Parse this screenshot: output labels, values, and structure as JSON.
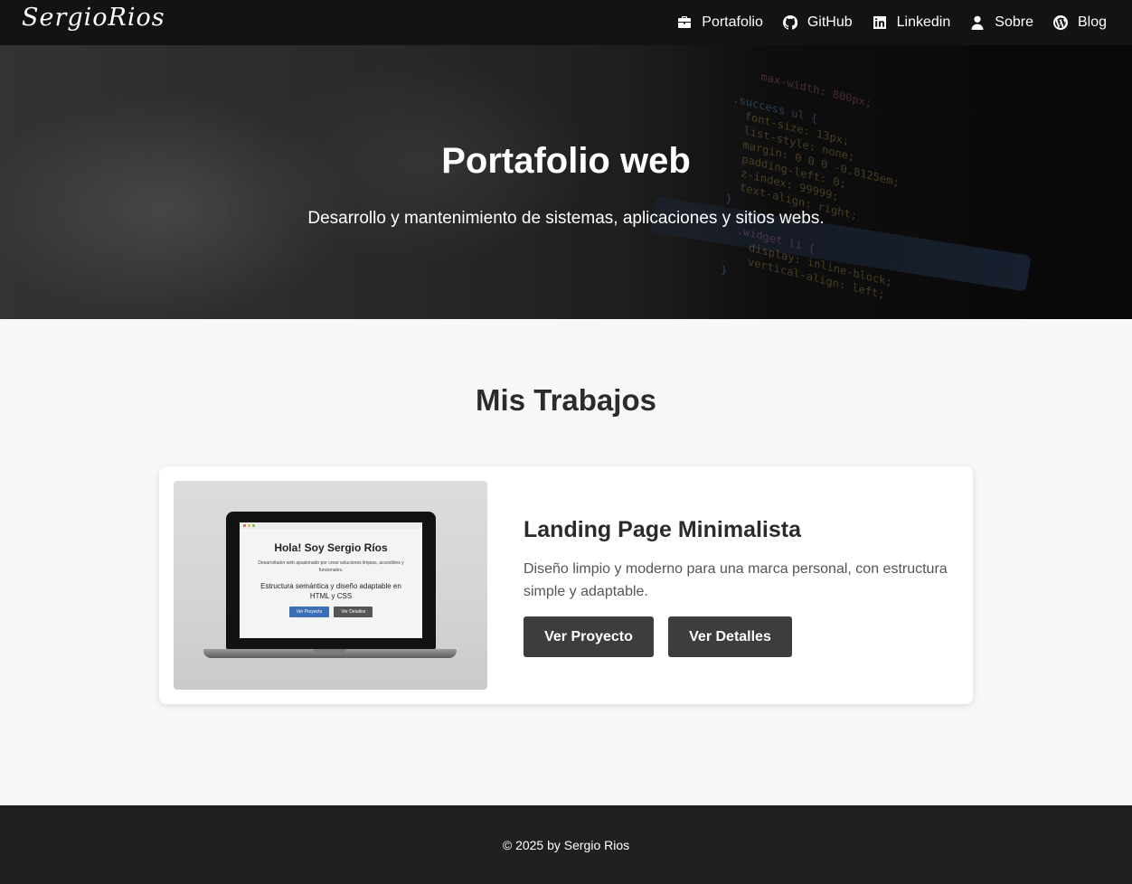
{
  "nav": {
    "logo": "SergioRios",
    "links": [
      {
        "label": "Portafolio",
        "icon": "briefcase-icon"
      },
      {
        "label": "GitHub",
        "icon": "github-icon"
      },
      {
        "label": "Linkedin",
        "icon": "linkedin-icon"
      },
      {
        "label": "Sobre",
        "icon": "user-icon"
      },
      {
        "label": "Blog",
        "icon": "wordpress-icon"
      }
    ]
  },
  "hero": {
    "title": "Portafolio web",
    "subtitle": "Desarrollo y mantenimiento de sistemas, aplicaciones y sitios webs."
  },
  "works": {
    "title": "Mis Trabajos",
    "project": {
      "title": "Landing Page Minimalista",
      "description": "Diseño limpio y moderno para una marca personal, con estructura simple y adaptable.",
      "primary_button": "Ver Proyecto",
      "secondary_button": "Ver Detalles",
      "mockup": {
        "heading": "Hola! Soy Sergio Ríos",
        "text": "Desarrollador web apasionado por crear soluciones limpias, accesibles y funcionales.",
        "subheading": "Estructura semántica y diseño adaptable en HTML y CSS",
        "button_primary": "Ver Proyecto",
        "button_secondary": "Ver Detalles",
        "button_primary_color": "#3b6fb6",
        "button_secondary_color": "#555555"
      }
    }
  },
  "footer": {
    "text": "© 2025 by Sergio Rios"
  },
  "colors": {
    "navbar_bg": "#131313",
    "page_bg": "#f8f8f8",
    "button_bg": "#3d3d3d",
    "footer_bg": "#202020"
  }
}
